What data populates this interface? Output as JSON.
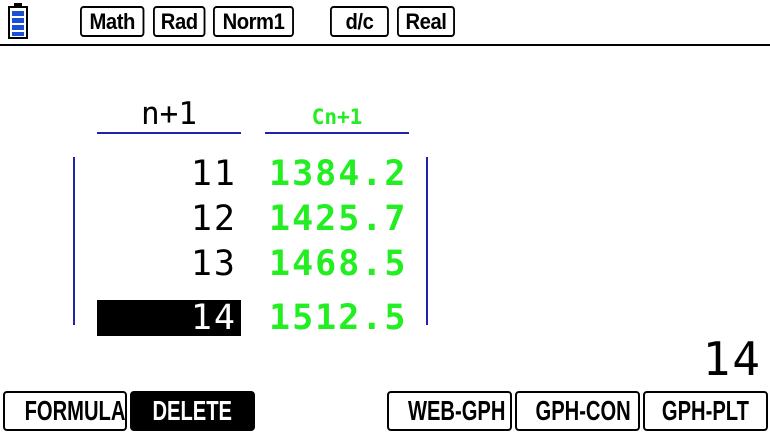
{
  "status_bar": {
    "modes": [
      "Math",
      "Rad",
      "Norm1",
      "d/c",
      "Real"
    ],
    "battery_color": "#1a4fd6"
  },
  "table": {
    "columns": [
      "n+1",
      "Cn+1"
    ],
    "rows": [
      {
        "n": "11",
        "c": "1384.2"
      },
      {
        "n": "12",
        "c": "1425.7"
      },
      {
        "n": "13",
        "c": "1468.5"
      },
      {
        "n": "14",
        "c": "1512.5"
      }
    ],
    "selected_row": 3,
    "value_color": "#22ee22",
    "rule_color": "#2222aa"
  },
  "entry_line": {
    "value": "14"
  },
  "function_keys": [
    "FORMULA",
    "DELETE",
    "WEB-GPH",
    "GPH-CON",
    "GPH-PLT"
  ]
}
